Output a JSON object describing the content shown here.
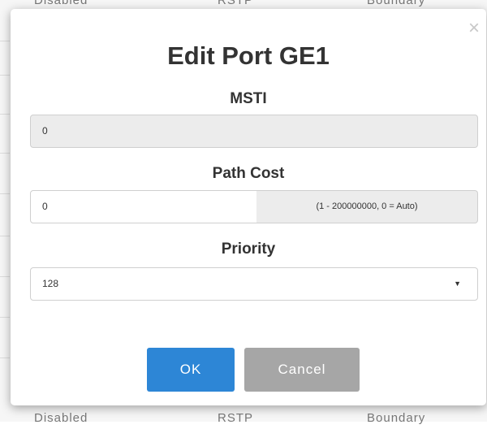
{
  "background_table": {
    "top_row": [
      "Disabled",
      "RSTP",
      "Boundary"
    ],
    "bottom_row": [
      "Disabled",
      "RSTP",
      "Boundary"
    ]
  },
  "modal": {
    "title": "Edit Port GE1",
    "close_icon": "close-icon",
    "msti": {
      "label": "MSTI",
      "value": "0"
    },
    "path_cost": {
      "label": "Path Cost",
      "value": "0",
      "hint": "(1 - 200000000, 0 = Auto)"
    },
    "priority": {
      "label": "Priority",
      "selected": "128"
    },
    "buttons": {
      "ok": "OK",
      "cancel": "Cancel"
    }
  },
  "colors": {
    "primary": "#2d86d6",
    "secondary": "#a6a6a6"
  }
}
